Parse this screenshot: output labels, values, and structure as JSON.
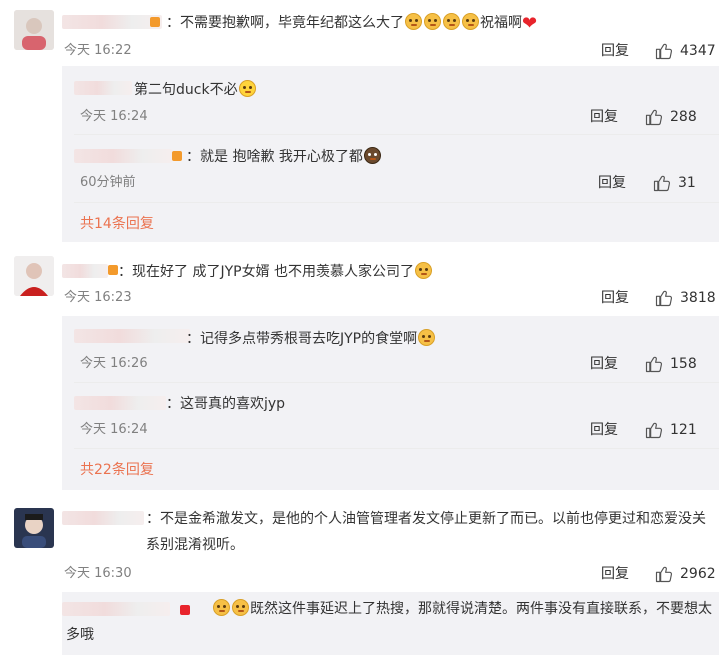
{
  "comments": [
    {
      "text_before": "：不需要抱歉啊，毕竟年纪都这么大了",
      "text_after": "祝福啊",
      "time": "今天 16:22",
      "reply_label": "回复",
      "likes": "4347",
      "replies": [
        {
          "text": "第二句duck不必",
          "time": "今天 16:24",
          "reply_label": "回复",
          "likes": "288"
        },
        {
          "text": "就是 抱啥歉 我开心极了都",
          "time": "60分钟前",
          "reply_label": "回复",
          "likes": "31"
        }
      ],
      "more": "共14条回复"
    },
    {
      "text": "：现在好了 成了JYP女婿 也不用羡慕人家公司了",
      "time": "今天 16:23",
      "reply_label": "回复",
      "likes": "3818",
      "replies": [
        {
          "text": "记得多点带秀根哥去吃JYP的食堂啊",
          "time": "今天 16:26",
          "reply_label": "回复",
          "likes": "158"
        },
        {
          "text": "这哥真的喜欢jyp",
          "time": "今天 16:24",
          "reply_label": "回复",
          "likes": "121"
        }
      ],
      "more": "共22条回复"
    },
    {
      "text": "：不是金希澈发文，是他的个人油管管理者发文停止更新了而已。以前也停更过和恋爱没关系别混淆视听。",
      "time": "今天 16:30",
      "reply_label": "回复",
      "likes": "2962",
      "replies": [
        {
          "text": "既然这件事延迟上了热搜，那就得说清楚。两件事没有直接联系，不要想太多哦"
        }
      ]
    }
  ],
  "icons": {
    "like": "thumbs-up-icon",
    "emoji": "doge-emoji-icon",
    "heart": "heart-icon"
  },
  "colors": {
    "link": "#eb7350",
    "reply_bg": "#f2f2f5",
    "meta": "#808080"
  }
}
